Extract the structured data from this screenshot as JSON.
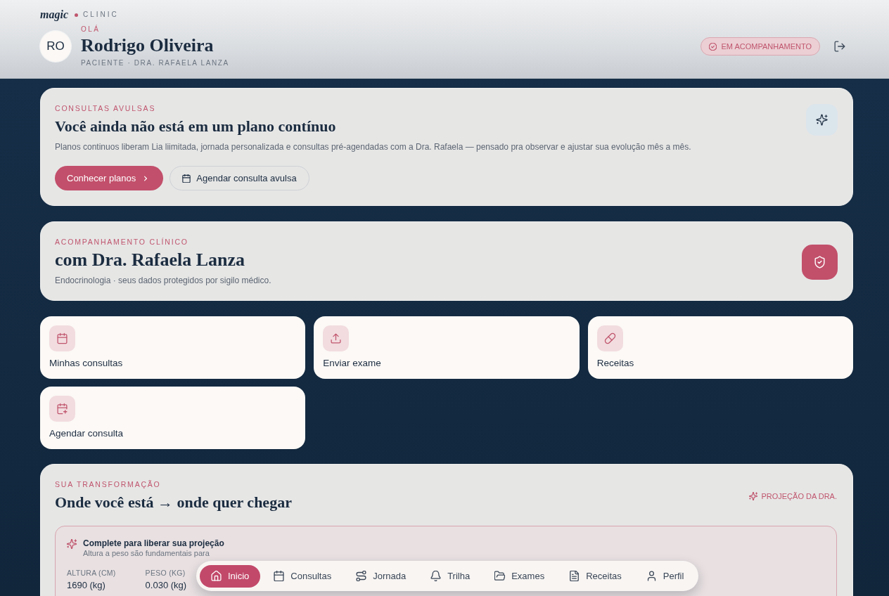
{
  "header": {
    "logo": {
      "wordmark": "magic",
      "suffix": "CLINIC"
    },
    "avatar": {
      "initials": "RO"
    },
    "greeting": "OLÁ",
    "name": "Rodrigo Oliveira",
    "subtitle": "PACIENTE · DRA. RAFAELA LANZA",
    "status_badge": "EM ACOMPANHAMENTO"
  },
  "plan_card": {
    "eyebrow": "CONSULTAS AVULSAS",
    "title": "Você ainda não está em um plano contínuo",
    "description": "Planos continuos liberam Lia liimitada, jornada personalizada e consultas pré-agendadas com a Dra. Rafaela — pensado pra observar e ajustar sua evolução mês a mês.",
    "buttons": [
      {
        "label": "Conhecer planos",
        "kind": "primary"
      },
      {
        "label": "Agendar consulta avulsa",
        "kind": "secondary"
      }
    ]
  },
  "care_card": {
    "eyebrow": "ACOMPANHAMENTO CLÍNICO",
    "title": "com Dra. Rafaela Lanza",
    "description": "Endocrinologia · seus dados protegidos por sigilo médico."
  },
  "quick_actions": [
    {
      "label": "Minhas consultas",
      "kind": "appointments"
    },
    {
      "label": "Enviar exame",
      "kind": "upload"
    },
    {
      "label": "Receitas",
      "kind": "prescriptions"
    },
    {
      "label": "Agendar consulta",
      "kind": "booking"
    }
  ],
  "transformation": {
    "eyebrow": "SUA TRANSFORMAÇÃO",
    "title": "Onde você está → onde quer chegar",
    "badge": "PROJEÇÃO DA DRA.",
    "notice": {
      "title": "Complete para liberar sua projeção",
      "hint": "Altura a peso são fundamentais para"
    },
    "fields": [
      {
        "label": "ALTURA (CM)",
        "value": "1690 (kg)"
      },
      {
        "label": "PESO (KG)",
        "value": "0.030 (kg)"
      }
    ]
  },
  "bottom_nav": {
    "items": [
      {
        "label": "Inicio",
        "kind": "home",
        "selected": true
      },
      {
        "label": "Consultas",
        "kind": "appointments",
        "selected": false
      },
      {
        "label": "Jornada",
        "kind": "journey",
        "selected": false
      },
      {
        "label": "Trilha",
        "kind": "track",
        "selected": false
      },
      {
        "label": "Exames",
        "kind": "exams",
        "selected": false
      },
      {
        "label": "Receitas",
        "kind": "prescriptions",
        "selected": false
      },
      {
        "label": "Perfil",
        "kind": "profile",
        "selected": false
      }
    ]
  }
}
